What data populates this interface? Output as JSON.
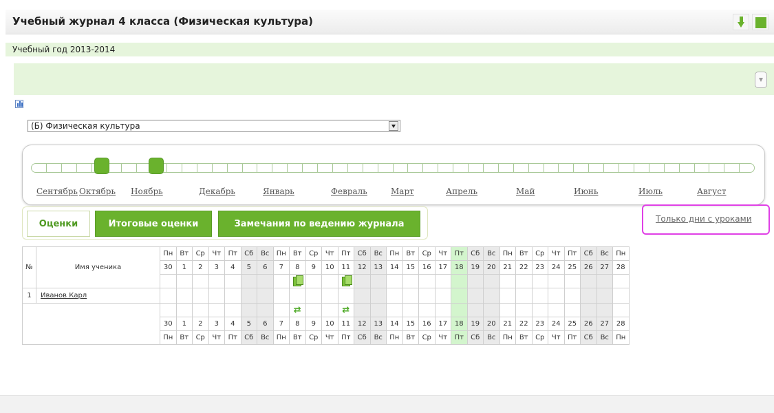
{
  "title": "Учебный журнал 4 класса (Физическая культура)",
  "school_year": "Учебный год 2013-2014",
  "subject_select": {
    "value": "(Б) Физическая культура"
  },
  "months": [
    "Сентябрь",
    "Октябрь",
    "Ноябрь",
    "Декабрь",
    "Январь",
    "Февраль",
    "Март",
    "Апрель",
    "Май",
    "Июнь",
    "Июль",
    "Август"
  ],
  "tabs": [
    {
      "label": "Оценки",
      "active": true
    },
    {
      "label": "Итоговые оценки",
      "active": false
    },
    {
      "label": "Замечания по ведению журнала",
      "active": false
    }
  ],
  "lessons_only_link": "Только дни с уроками",
  "table": {
    "num_header": "№",
    "name_header": "Имя ученика",
    "days": [
      {
        "dow": "Пн",
        "d": "30"
      },
      {
        "dow": "Вт",
        "d": "1"
      },
      {
        "dow": "Ср",
        "d": "2"
      },
      {
        "dow": "Чт",
        "d": "3"
      },
      {
        "dow": "Пт",
        "d": "4"
      },
      {
        "dow": "Сб",
        "d": "5"
      },
      {
        "dow": "Вс",
        "d": "6"
      },
      {
        "dow": "Пн",
        "d": "7"
      },
      {
        "dow": "Вт",
        "d": "8"
      },
      {
        "dow": "Ср",
        "d": "9"
      },
      {
        "dow": "Чт",
        "d": "10"
      },
      {
        "dow": "Пт",
        "d": "11"
      },
      {
        "dow": "Сб",
        "d": "12"
      },
      {
        "dow": "Вс",
        "d": "13"
      },
      {
        "dow": "Пн",
        "d": "14"
      },
      {
        "dow": "Вт",
        "d": "15"
      },
      {
        "dow": "Ср",
        "d": "16"
      },
      {
        "dow": "Чт",
        "d": "17"
      },
      {
        "dow": "Пт",
        "d": "18"
      },
      {
        "dow": "Сб",
        "d": "19"
      },
      {
        "dow": "Вс",
        "d": "20"
      },
      {
        "dow": "Пн",
        "d": "21"
      },
      {
        "dow": "Вт",
        "d": "22"
      },
      {
        "dow": "Ср",
        "d": "23"
      },
      {
        "dow": "Чт",
        "d": "24"
      },
      {
        "dow": "Пт",
        "d": "25"
      },
      {
        "dow": "Сб",
        "d": "26"
      },
      {
        "dow": "Вс",
        "d": "27"
      },
      {
        "dow": "Пн",
        "d": "28"
      }
    ],
    "weekend_indexes": [
      5,
      6,
      12,
      13,
      19,
      20,
      26,
      27
    ],
    "today_index": 18,
    "lesson_indexes": [
      8,
      11
    ],
    "students": [
      {
        "num": "1",
        "name": "Иванов Карл"
      }
    ]
  }
}
